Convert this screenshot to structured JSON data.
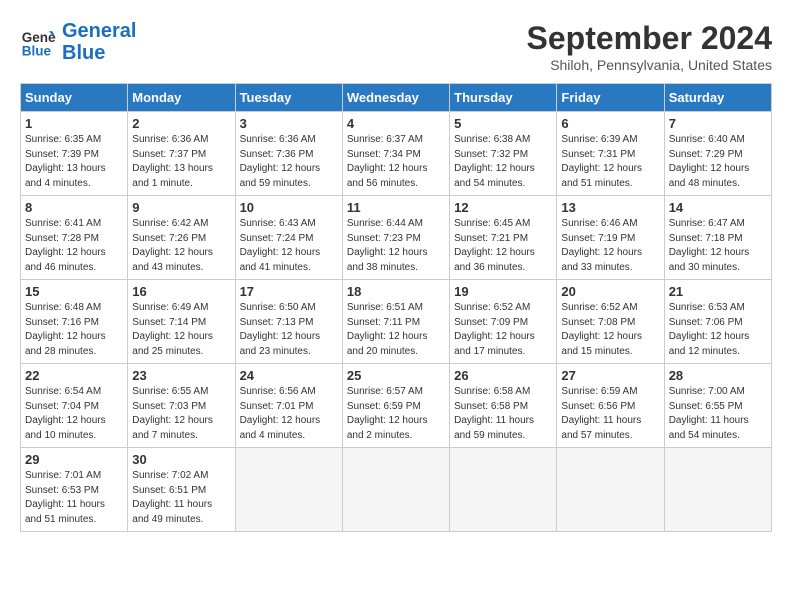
{
  "header": {
    "logo_line1": "General",
    "logo_line2": "Blue",
    "month": "September 2024",
    "location": "Shiloh, Pennsylvania, United States"
  },
  "weekdays": [
    "Sunday",
    "Monday",
    "Tuesday",
    "Wednesday",
    "Thursday",
    "Friday",
    "Saturday"
  ],
  "weeks": [
    [
      {
        "day": "1",
        "sunrise": "Sunrise: 6:35 AM",
        "sunset": "Sunset: 7:39 PM",
        "daylight": "Daylight: 13 hours and 4 minutes."
      },
      {
        "day": "2",
        "sunrise": "Sunrise: 6:36 AM",
        "sunset": "Sunset: 7:37 PM",
        "daylight": "Daylight: 13 hours and 1 minute."
      },
      {
        "day": "3",
        "sunrise": "Sunrise: 6:36 AM",
        "sunset": "Sunset: 7:36 PM",
        "daylight": "Daylight: 12 hours and 59 minutes."
      },
      {
        "day": "4",
        "sunrise": "Sunrise: 6:37 AM",
        "sunset": "Sunset: 7:34 PM",
        "daylight": "Daylight: 12 hours and 56 minutes."
      },
      {
        "day": "5",
        "sunrise": "Sunrise: 6:38 AM",
        "sunset": "Sunset: 7:32 PM",
        "daylight": "Daylight: 12 hours and 54 minutes."
      },
      {
        "day": "6",
        "sunrise": "Sunrise: 6:39 AM",
        "sunset": "Sunset: 7:31 PM",
        "daylight": "Daylight: 12 hours and 51 minutes."
      },
      {
        "day": "7",
        "sunrise": "Sunrise: 6:40 AM",
        "sunset": "Sunset: 7:29 PM",
        "daylight": "Daylight: 12 hours and 48 minutes."
      }
    ],
    [
      {
        "day": "8",
        "sunrise": "Sunrise: 6:41 AM",
        "sunset": "Sunset: 7:28 PM",
        "daylight": "Daylight: 12 hours and 46 minutes."
      },
      {
        "day": "9",
        "sunrise": "Sunrise: 6:42 AM",
        "sunset": "Sunset: 7:26 PM",
        "daylight": "Daylight: 12 hours and 43 minutes."
      },
      {
        "day": "10",
        "sunrise": "Sunrise: 6:43 AM",
        "sunset": "Sunset: 7:24 PM",
        "daylight": "Daylight: 12 hours and 41 minutes."
      },
      {
        "day": "11",
        "sunrise": "Sunrise: 6:44 AM",
        "sunset": "Sunset: 7:23 PM",
        "daylight": "Daylight: 12 hours and 38 minutes."
      },
      {
        "day": "12",
        "sunrise": "Sunrise: 6:45 AM",
        "sunset": "Sunset: 7:21 PM",
        "daylight": "Daylight: 12 hours and 36 minutes."
      },
      {
        "day": "13",
        "sunrise": "Sunrise: 6:46 AM",
        "sunset": "Sunset: 7:19 PM",
        "daylight": "Daylight: 12 hours and 33 minutes."
      },
      {
        "day": "14",
        "sunrise": "Sunrise: 6:47 AM",
        "sunset": "Sunset: 7:18 PM",
        "daylight": "Daylight: 12 hours and 30 minutes."
      }
    ],
    [
      {
        "day": "15",
        "sunrise": "Sunrise: 6:48 AM",
        "sunset": "Sunset: 7:16 PM",
        "daylight": "Daylight: 12 hours and 28 minutes."
      },
      {
        "day": "16",
        "sunrise": "Sunrise: 6:49 AM",
        "sunset": "Sunset: 7:14 PM",
        "daylight": "Daylight: 12 hours and 25 minutes."
      },
      {
        "day": "17",
        "sunrise": "Sunrise: 6:50 AM",
        "sunset": "Sunset: 7:13 PM",
        "daylight": "Daylight: 12 hours and 23 minutes."
      },
      {
        "day": "18",
        "sunrise": "Sunrise: 6:51 AM",
        "sunset": "Sunset: 7:11 PM",
        "daylight": "Daylight: 12 hours and 20 minutes."
      },
      {
        "day": "19",
        "sunrise": "Sunrise: 6:52 AM",
        "sunset": "Sunset: 7:09 PM",
        "daylight": "Daylight: 12 hours and 17 minutes."
      },
      {
        "day": "20",
        "sunrise": "Sunrise: 6:52 AM",
        "sunset": "Sunset: 7:08 PM",
        "daylight": "Daylight: 12 hours and 15 minutes."
      },
      {
        "day": "21",
        "sunrise": "Sunrise: 6:53 AM",
        "sunset": "Sunset: 7:06 PM",
        "daylight": "Daylight: 12 hours and 12 minutes."
      }
    ],
    [
      {
        "day": "22",
        "sunrise": "Sunrise: 6:54 AM",
        "sunset": "Sunset: 7:04 PM",
        "daylight": "Daylight: 12 hours and 10 minutes."
      },
      {
        "day": "23",
        "sunrise": "Sunrise: 6:55 AM",
        "sunset": "Sunset: 7:03 PM",
        "daylight": "Daylight: 12 hours and 7 minutes."
      },
      {
        "day": "24",
        "sunrise": "Sunrise: 6:56 AM",
        "sunset": "Sunset: 7:01 PM",
        "daylight": "Daylight: 12 hours and 4 minutes."
      },
      {
        "day": "25",
        "sunrise": "Sunrise: 6:57 AM",
        "sunset": "Sunset: 6:59 PM",
        "daylight": "Daylight: 12 hours and 2 minutes."
      },
      {
        "day": "26",
        "sunrise": "Sunrise: 6:58 AM",
        "sunset": "Sunset: 6:58 PM",
        "daylight": "Daylight: 11 hours and 59 minutes."
      },
      {
        "day": "27",
        "sunrise": "Sunrise: 6:59 AM",
        "sunset": "Sunset: 6:56 PM",
        "daylight": "Daylight: 11 hours and 57 minutes."
      },
      {
        "day": "28",
        "sunrise": "Sunrise: 7:00 AM",
        "sunset": "Sunset: 6:55 PM",
        "daylight": "Daylight: 11 hours and 54 minutes."
      }
    ],
    [
      {
        "day": "29",
        "sunrise": "Sunrise: 7:01 AM",
        "sunset": "Sunset: 6:53 PM",
        "daylight": "Daylight: 11 hours and 51 minutes."
      },
      {
        "day": "30",
        "sunrise": "Sunrise: 7:02 AM",
        "sunset": "Sunset: 6:51 PM",
        "daylight": "Daylight: 11 hours and 49 minutes."
      },
      null,
      null,
      null,
      null,
      null
    ]
  ]
}
